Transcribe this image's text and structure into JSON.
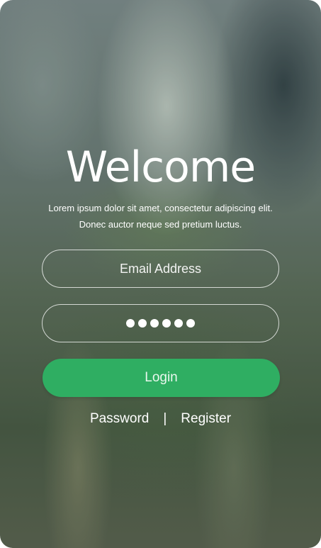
{
  "welcome": {
    "title": "Welcome",
    "subtitle_line1": "Lorem ipsum dolor sit amet, consectetur adipiscing elit.",
    "subtitle_line2": "Donec auctor neque sed pretium luctus."
  },
  "form": {
    "email_placeholder": "Email Address",
    "password_mask_length": 6,
    "login_label": "Login"
  },
  "footer_links": {
    "password_label": "Password",
    "separator": "|",
    "register_label": "Register"
  },
  "colors": {
    "accent": "#2fae62",
    "text": "#ffffff"
  }
}
